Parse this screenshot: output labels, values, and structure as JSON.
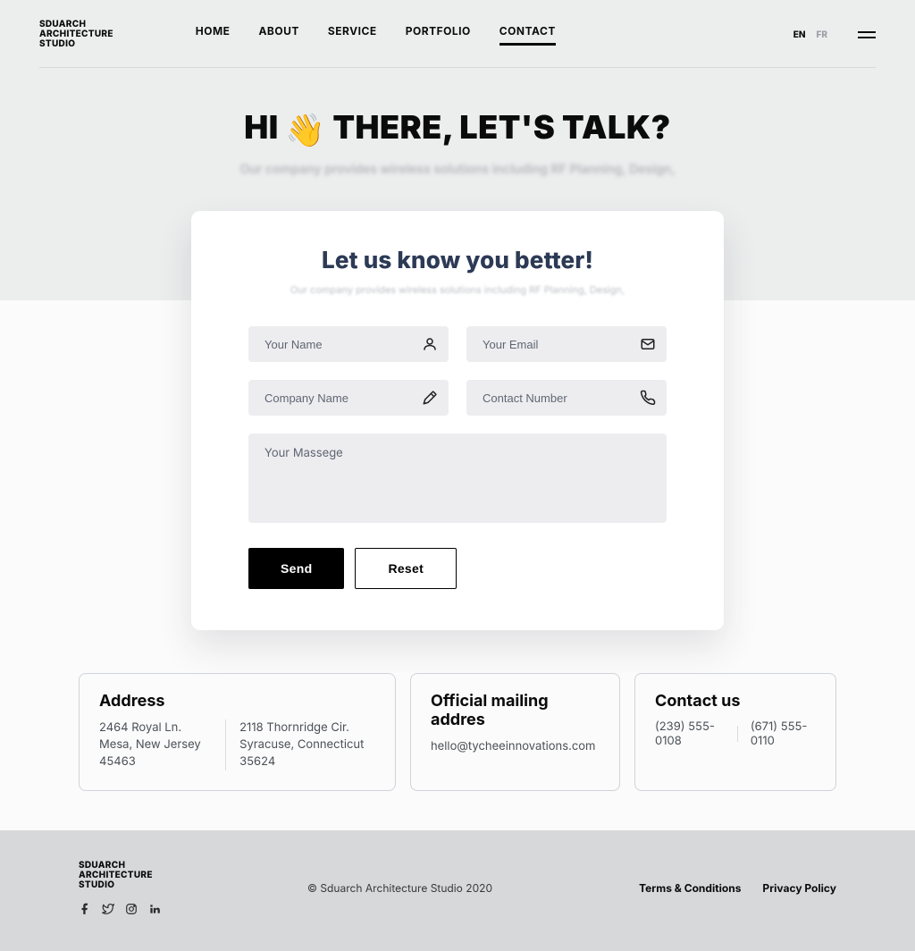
{
  "brand": {
    "line1": "SDUARCH",
    "line2": "ARCHITECTURE",
    "line3": "STUDIO"
  },
  "nav": {
    "home": "HOME",
    "about": "ABOUT",
    "service": "SERVICE",
    "portfolio": "PORTFOLIO",
    "contact": "CONTACT"
  },
  "lang": {
    "en": "EN",
    "fr": "FR"
  },
  "hero": {
    "hi": "HI",
    "wave": "👋",
    "rest": " THERE, LET'S TALK?",
    "subtitle": "Our company provides wireless solutions including RF Planning, Design,"
  },
  "form": {
    "title": "Let us know you better!",
    "subtitle": "Our company provides wireless solutions including RF Planning, Design,",
    "name_ph": "Your Name",
    "email_ph": "Your Email",
    "company_ph": "Company Name",
    "phone_ph": "Contact Number",
    "message_ph": "Your Massege",
    "send": "Send",
    "reset": "Reset"
  },
  "info": {
    "address": {
      "title": "Address",
      "a1": "2464 Royal Ln. Mesa, New Jersey 45463",
      "a2": "2118 Thornridge Cir. Syracuse, Connecticut 35624"
    },
    "mail": {
      "title": "Official mailing addres",
      "value": "hello@tycheeinnovations.com"
    },
    "contact": {
      "title": "Contact us",
      "p1": "(239) 555-0108",
      "p2": "(671) 555-0110"
    }
  },
  "footer": {
    "copyright": "© Sduarch Architecture Studio 2020",
    "terms": "Terms & Conditions",
    "privacy": "Privacy Policy"
  }
}
